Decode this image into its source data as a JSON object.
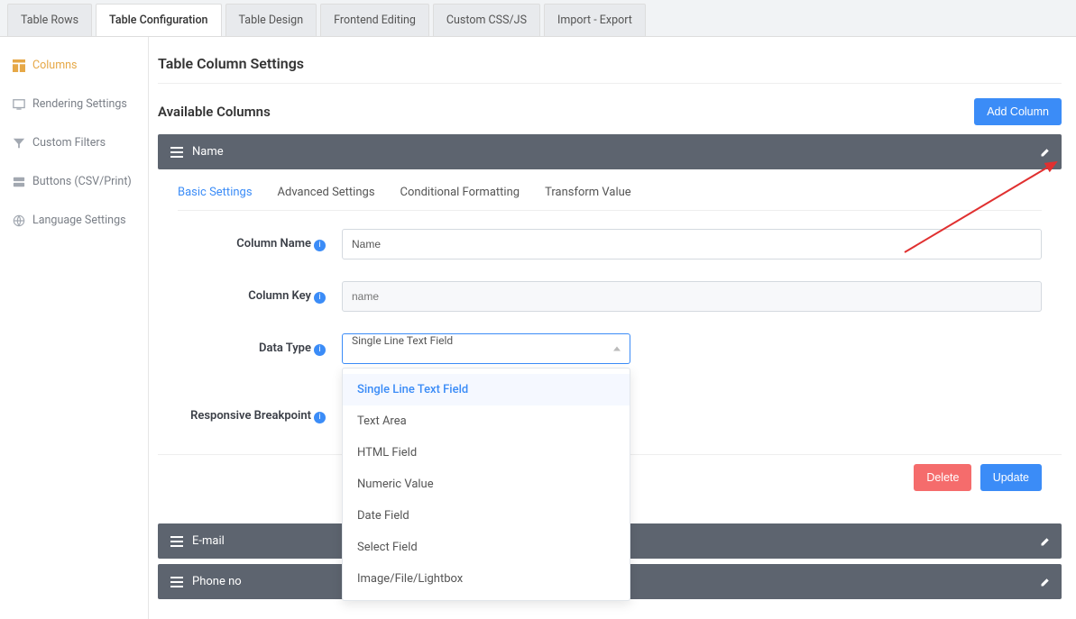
{
  "topTabs": {
    "rows": "Table Rows",
    "config": "Table Configuration",
    "design": "Table Design",
    "frontend": "Frontend Editing",
    "css": "Custom CSS/JS",
    "import": "Import - Export"
  },
  "sidebar": {
    "columns": "Columns",
    "rendering": "Rendering Settings",
    "filters": "Custom Filters",
    "buttons": "Buttons (CSV/Print)",
    "language": "Language Settings"
  },
  "page": {
    "title": "Table Column Settings",
    "available": "Available Columns",
    "addColumn": "Add Column"
  },
  "column": {
    "name": "Name"
  },
  "innerTabs": {
    "basic": "Basic Settings",
    "advanced": "Advanced Settings",
    "conditional": "Conditional Formatting",
    "transform": "Transform Value"
  },
  "form": {
    "columnNameLabel": "Column Name",
    "columnNameValue": "Name",
    "columnKeyLabel": "Column Key",
    "columnKeyPlaceholder": "name",
    "dataTypeLabel": "Data Type",
    "dataTypeValue": "Single Line Text Field",
    "breakpointLabel": "Responsive Breakpoint"
  },
  "dataTypeOptions": {
    "o0": "Single Line Text Field",
    "o1": "Text Area",
    "o2": "HTML Field",
    "o3": "Numeric Value",
    "o4": "Date Field",
    "o5": "Select Field",
    "o6": "Image/File/Lightbox"
  },
  "actions": {
    "delete": "Delete",
    "update": "Update"
  },
  "collapsed": {
    "email": "E-mail",
    "phone": "Phone no"
  }
}
